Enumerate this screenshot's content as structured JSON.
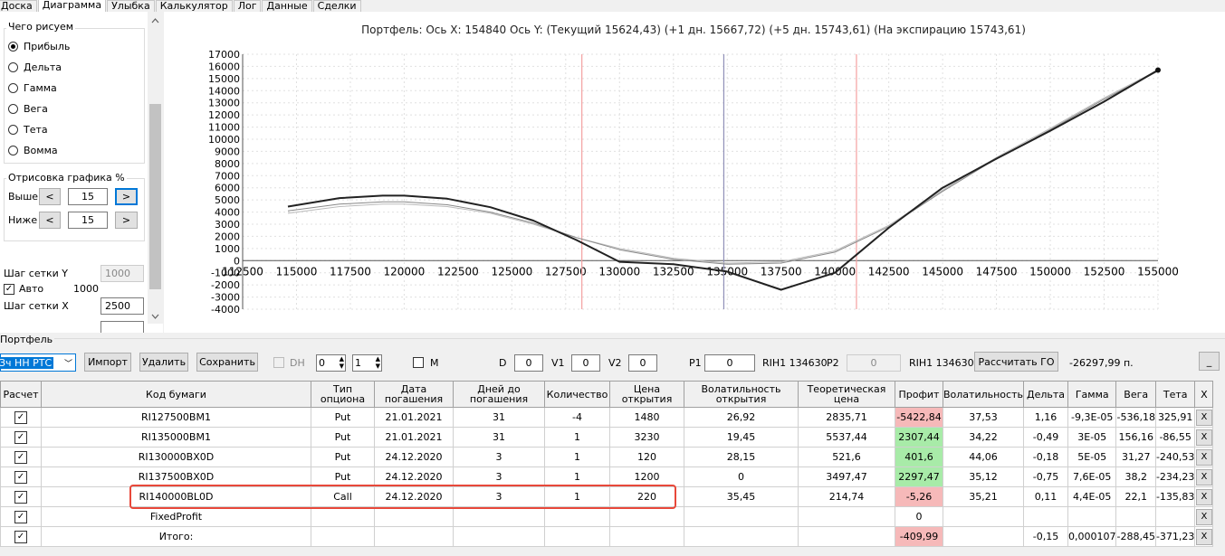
{
  "tabs": [
    "Доска",
    "Диаграмма",
    "Улыбка",
    "Калькулятор",
    "Лог",
    "Данные",
    "Сделки"
  ],
  "left": {
    "what_title": "Чего рисуем",
    "radios": [
      "Прибыль",
      "Дельта",
      "Гамма",
      "Вега",
      "Тета",
      "Вомма"
    ],
    "draw_title": "Отрисовка графика %",
    "above_label": "Выше",
    "above_value": "15",
    "below_label": "Ниже",
    "below_value": "15",
    "grid_y_label": "Шаг сетки Y",
    "grid_y_value": "1000",
    "auto_label": "Авто",
    "auto_value": "1000",
    "grid_x_label": "Шаг сетки X",
    "grid_x_value": "2500",
    "btn_prev": "<",
    "btn_next": ">"
  },
  "chart_data": {
    "type": "line",
    "title": "Портфель: Ось X: 154840 Ось Y:  (Текущий 15624,43)  (+1 дн. 15667,72)  (+5 дн. 15743,61)  (На экспирацию 15743,61)",
    "xlim": [
      112500,
      155000
    ],
    "ylim": [
      -4000,
      17000
    ],
    "xticks": [
      112500,
      115000,
      117500,
      120000,
      122500,
      125000,
      127500,
      130000,
      132500,
      135000,
      137500,
      140000,
      142500,
      145000,
      147500,
      150000,
      152500,
      155000
    ],
    "yticks": [
      -4000,
      -3000,
      -2000,
      -1000,
      0,
      1000,
      2000,
      3000,
      4000,
      5000,
      6000,
      7000,
      8000,
      9000,
      10000,
      11000,
      12000,
      13000,
      14000,
      15000,
      16000,
      17000
    ],
    "vlines": [
      {
        "x": 128250,
        "color": "#f4a0a0"
      },
      {
        "x": 134840,
        "color": "#9090b8"
      },
      {
        "x": 141000,
        "color": "#f4a0a0"
      }
    ],
    "series": [
      {
        "color": "#222222",
        "width": 2,
        "x": [
          114600,
          117000,
          119000,
          120000,
          122000,
          124000,
          126000,
          128000,
          130000,
          132500,
          135000,
          137500,
          140000,
          142500,
          145000,
          147500,
          150000,
          152500,
          155000
        ],
        "y": [
          4450,
          5150,
          5350,
          5350,
          5100,
          4400,
          3300,
          1700,
          -100,
          -300,
          -900,
          -2400,
          -1000,
          2700,
          6000,
          8400,
          10700,
          13100,
          15700
        ]
      },
      {
        "color": "#888888",
        "width": 1,
        "x": [
          114600,
          117000,
          119000,
          120000,
          122000,
          124000,
          126000,
          128000,
          130000,
          132500,
          135000,
          137500,
          140000,
          142500,
          145000,
          147500,
          150000,
          152500,
          155000
        ],
        "y": [
          4100,
          4650,
          4850,
          4850,
          4600,
          4000,
          3100,
          1900,
          900,
          100,
          -300,
          -200,
          700,
          2800,
          5700,
          8400,
          10800,
          13300,
          15600
        ]
      },
      {
        "color": "#bbbbbb",
        "width": 1,
        "x": [
          114600,
          117000,
          119000,
          120000,
          122000,
          124000,
          126000,
          128000,
          130000,
          132500,
          135000,
          137500,
          140000,
          142500,
          145000,
          147500,
          150000,
          152500,
          155000
        ],
        "y": [
          3900,
          4450,
          4650,
          4650,
          4450,
          3900,
          3000,
          1900,
          1000,
          200,
          -200,
          -100,
          800,
          2900,
          5800,
          8500,
          10900,
          13400,
          15700
        ]
      }
    ]
  },
  "portfolio": {
    "label": "Портфель",
    "select": "Зч НН РТС",
    "import": "Импорт",
    "delete": "Удалить",
    "save": "Сохранить",
    "dh": "DH",
    "dh_v1": "0",
    "dh_v2": "1",
    "m": "M",
    "d_label": "D",
    "d_value": "0",
    "v1_label": "V1",
    "v1_value": "0",
    "v2_label": "V2",
    "v2_value": "0",
    "p1_label": "P1",
    "p1_value": "0",
    "ric1": "RIH1 134630",
    "p2_label": "P2",
    "p2_value": "0",
    "ric2": "RIH1 134630",
    "calc_go": "Рассчитать ГО",
    "go_value": "-26297,99 п.",
    "min_btn": "_"
  },
  "table": {
    "headers": [
      "Расчет",
      "Код бумаги",
      "Тип опциона",
      "Дата погашения",
      "Дней до погашения",
      "Количество",
      "Цена открытия",
      "Волатильность открытия",
      "Теоретическая цена",
      "Профит",
      "Волатильность",
      "Дельта",
      "Гамма",
      "Вега",
      "Тета",
      "X"
    ],
    "rows": [
      {
        "code": "RI127500BM1",
        "type": "Put",
        "date": "21.01.2021",
        "days": "31",
        "qty": "-4",
        "price": "1480",
        "vol_open": "26,92",
        "theo": "2835,71",
        "profit": "-5422,84",
        "profit_cls": "red",
        "vol": "37,53",
        "delta": "1,16",
        "gamma": "-9,3E-05",
        "vega": "-536,18",
        "theta": "325,91"
      },
      {
        "code": "RI135000BM1",
        "type": "Put",
        "date": "21.01.2021",
        "days": "31",
        "qty": "1",
        "price": "3230",
        "vol_open": "19,45",
        "theo": "5537,44",
        "profit": "2307,44",
        "profit_cls": "green",
        "vol": "34,22",
        "delta": "-0,49",
        "gamma": "3E-05",
        "vega": "156,16",
        "theta": "-86,55"
      },
      {
        "code": "RI130000BX0D",
        "type": "Put",
        "date": "24.12.2020",
        "days": "3",
        "qty": "1",
        "price": "120",
        "vol_open": "28,15",
        "theo": "521,6",
        "profit": "401,6",
        "profit_cls": "green",
        "vol": "44,06",
        "delta": "-0,18",
        "gamma": "5E-05",
        "vega": "31,27",
        "theta": "-240,53"
      },
      {
        "code": "RI137500BX0D",
        "type": "Put",
        "date": "24.12.2020",
        "days": "3",
        "qty": "1",
        "price": "1200",
        "vol_open": "0",
        "theo": "3497,47",
        "profit": "2297,47",
        "profit_cls": "green",
        "vol": "35,12",
        "delta": "-0,75",
        "gamma": "7,6E-05",
        "vega": "38,2",
        "theta": "-234,23"
      },
      {
        "code": "RI140000BL0D",
        "type": "Call",
        "date": "24.12.2020",
        "days": "3",
        "qty": "1",
        "price": "220",
        "vol_open": "35,45",
        "theo": "214,74",
        "profit": "-5,26",
        "profit_cls": "red",
        "vol": "35,21",
        "delta": "0,11",
        "gamma": "4,4E-05",
        "vega": "22,1",
        "theta": "-135,83"
      },
      {
        "code": "FixedProfit",
        "type": "",
        "date": "",
        "days": "",
        "qty": "",
        "price": "",
        "vol_open": "",
        "theo": "",
        "profit": "0",
        "profit_cls": "",
        "vol": "",
        "delta": "",
        "gamma": "",
        "vega": "",
        "theta": ""
      },
      {
        "code": "Итого:",
        "type": "",
        "date": "",
        "days": "",
        "qty": "",
        "price": "",
        "vol_open": "",
        "theo": "",
        "profit": "-409,99",
        "profit_cls": "red",
        "vol": "",
        "delta": "-0,15",
        "gamma": "0,000107",
        "vega": "-288,45",
        "theta": "-371,23"
      }
    ],
    "x_label": "X"
  },
  "highlight_color": "#e8483a"
}
